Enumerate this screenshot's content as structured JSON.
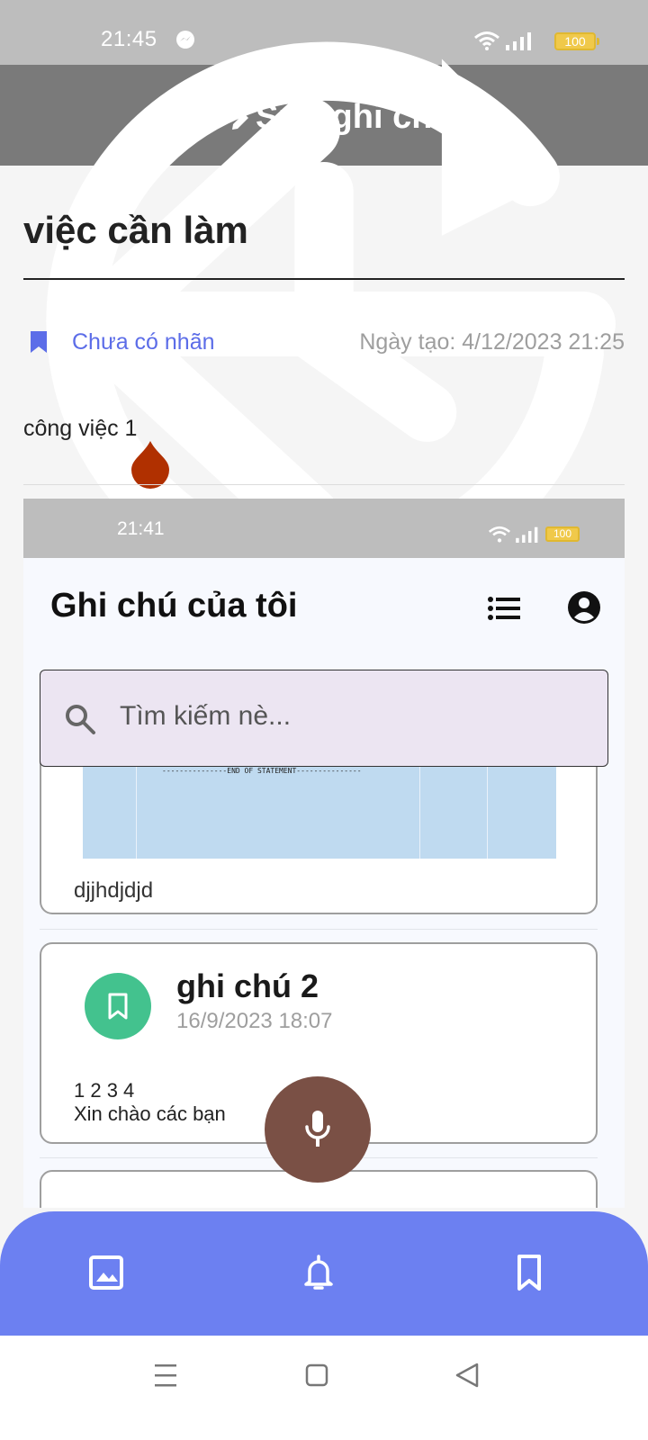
{
  "status_bar": {
    "time": "21:45",
    "battery": "100"
  },
  "app_bar": {
    "title": "Sửa ghi chú"
  },
  "note": {
    "title": "việc cần làm",
    "label": "Chưa có nhãn",
    "created": "Ngày tạo: 4/12/2023 21:25",
    "content": "công việc 1"
  },
  "embedded_screenshot": {
    "status_time": "21:41",
    "battery": "100",
    "heading": "Ghi chú của tôi",
    "search_placeholder": "Tìm kiếm nè...",
    "statement_text": "---------------END OF STATEMENT---------------",
    "card1_text": "djjhdjdjd",
    "card2": {
      "title": "ghi chú 2",
      "date": "16/9/2023 18:07",
      "line1": "1 2 3 4",
      "line2": "Xin chào các bạn"
    }
  },
  "colors": {
    "app_bar": "#7a7a7a",
    "accent": "#6c80f1",
    "label": "#5c6de8",
    "mic_button": "#7a5045",
    "drop_handle": "#b03000",
    "tag_green": "#43c28e"
  },
  "icons": {
    "app_bar": [
      "back-arrow-icon",
      "edit-note-icon",
      "history-icon"
    ],
    "bottom_bar": [
      "image-icon",
      "bell-icon",
      "bookmark-icon"
    ],
    "nav_bar": [
      "menu-icon",
      "home-square-icon",
      "back-triangle-icon"
    ]
  }
}
